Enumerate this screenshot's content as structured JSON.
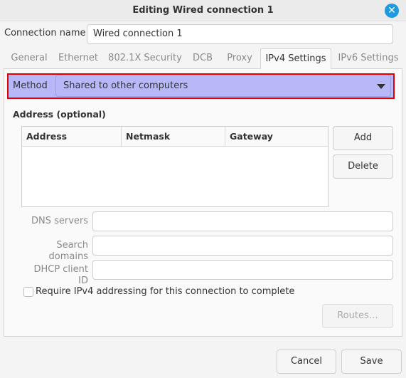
{
  "window": {
    "title": "Editing Wired connection 1",
    "close_icon": "close-icon"
  },
  "connection_name": {
    "label": "Connection name",
    "value": "Wired connection 1"
  },
  "tabs": [
    {
      "label": "General"
    },
    {
      "label": "Ethernet"
    },
    {
      "label": "802.1X Security"
    },
    {
      "label": "DCB"
    },
    {
      "label": "Proxy"
    },
    {
      "label": "IPv4 Settings",
      "active": true
    },
    {
      "label": "IPv6 Settings"
    }
  ],
  "method": {
    "label": "Method",
    "value": "Shared to other computers",
    "highlight_color": "#b8b8f8",
    "outline_color": "#e00000"
  },
  "address": {
    "heading": "Address (optional)",
    "columns": [
      "Address",
      "Netmask",
      "Gateway"
    ],
    "rows": [],
    "add_label": "Add",
    "delete_label": "Delete"
  },
  "fields": {
    "dns_label": "DNS servers",
    "dns_value": "",
    "search_label": "Search domains",
    "search_value": "",
    "dhcp_label": "DHCP client ID",
    "dhcp_value": ""
  },
  "require": {
    "label": "Require IPv4 addressing for this connection to complete",
    "checked": false
  },
  "routes_label": "Routes…",
  "footer": {
    "cancel_label": "Cancel",
    "save_label": "Save"
  }
}
